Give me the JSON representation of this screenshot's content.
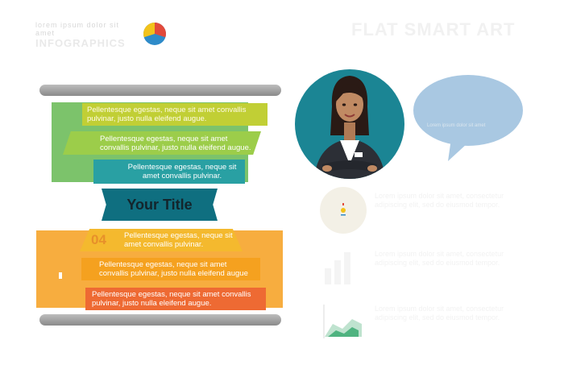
{
  "header": {
    "brand_line1": "lorem ipsum dolor sit amet",
    "brand_line2": "INFOGRAPHICS",
    "right_title": "FLAT SMART ART",
    "pie_colors": [
      "#f2c21b",
      "#2e8bc9",
      "#e24a3b"
    ]
  },
  "funnel": {
    "steps": [
      {
        "text": "Pellentesque egestas, neque sit amet convallis pulvinar, justo nulla eleifend augue.",
        "color": "#c1cf35"
      },
      {
        "text": "Pellentesque egestas, neque sit amet convallis pulvinar, justo nulla eleifend augue.",
        "color": "#9ccd4a"
      },
      {
        "text": "Pellentesque egestas, neque sit amet convallis pulvinar.",
        "color": "#29a0a3"
      },
      {
        "text": "Pellentesque egestas, neque sit amet convallis pulvinar.",
        "number": "04",
        "color": "#f4b92e"
      },
      {
        "text": "Pellentesque egestas, neque sit amet convallis pulvinar, justo nulla eleifend augue",
        "color": "#f5a11f"
      },
      {
        "text": "Pellentesque egestas, neque sit amet convallis pulvinar, justo nulla eleifend augue.",
        "color": "#ee6a33"
      }
    ],
    "title": "Your Title",
    "title_color": "#0f6f80"
  },
  "speech_bubble": {
    "text": "Lorem ipsum dolor sit amet",
    "color": "#a9c8e2"
  },
  "features": [
    {
      "icon": "pie-chart-icon",
      "text": "Lorem ipsum dolor sit amet, consectetur adipiscing elit, sed do eiusmod tempor."
    },
    {
      "icon": "bar-chart-icon",
      "text": "Lorem ipsum dolor sit amet, consectetur adipiscing elit, sed do eiusmod tempor."
    },
    {
      "icon": "area-chart-icon",
      "text": "Lorem ipsum dolor sit amet, consectetur adipiscing elit, sed do eiusmod tempor."
    }
  ]
}
